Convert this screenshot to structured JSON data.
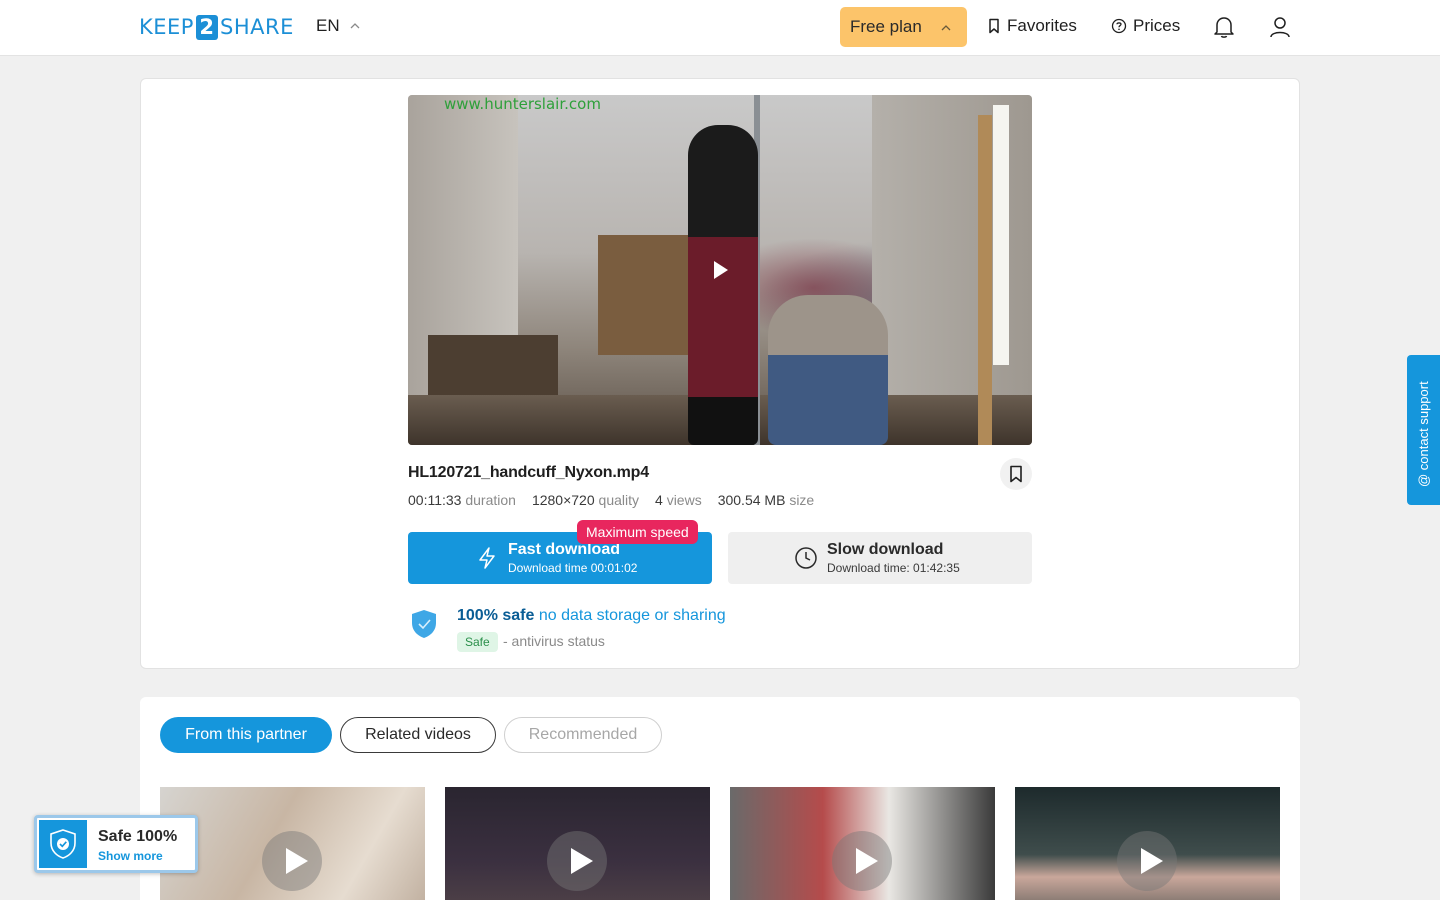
{
  "header": {
    "logo_left": "KEEP",
    "logo_mid": "2",
    "logo_right": "SHARE",
    "language": "EN",
    "plan_label": "Free plan",
    "favorites_label": "Favorites",
    "prices_label": "Prices"
  },
  "video": {
    "watermark": "www.hunterslair.com"
  },
  "file": {
    "name": "HL120721_handcuff_Nyxon.mp4",
    "duration_value": "00:11:33",
    "duration_label": "duration",
    "quality_value": "1280×720",
    "quality_label": "quality",
    "views_value": "4",
    "views_label": "views",
    "size_value": "300.54 MB",
    "size_label": "size"
  },
  "download": {
    "fast_label": "Fast download",
    "fast_time": "Download time 00:01:02",
    "max_badge": "Maximum speed",
    "slow_label": "Slow download",
    "slow_time": "Download time: 01:42:35"
  },
  "safety": {
    "safe_bold": "100% safe",
    "safe_text": " no data storage or sharing",
    "tag": "Safe",
    "status": "- antivirus status"
  },
  "tabs": {
    "partner": "From this partner",
    "related": "Related videos",
    "recommended": "Recommended"
  },
  "widget": {
    "title": "Safe 100%",
    "link": "Show more"
  },
  "contact": {
    "label": "@ contact support"
  },
  "colors": {
    "accent": "#1596dc",
    "plan": "#fcc46a",
    "badge": "#e8265e"
  }
}
